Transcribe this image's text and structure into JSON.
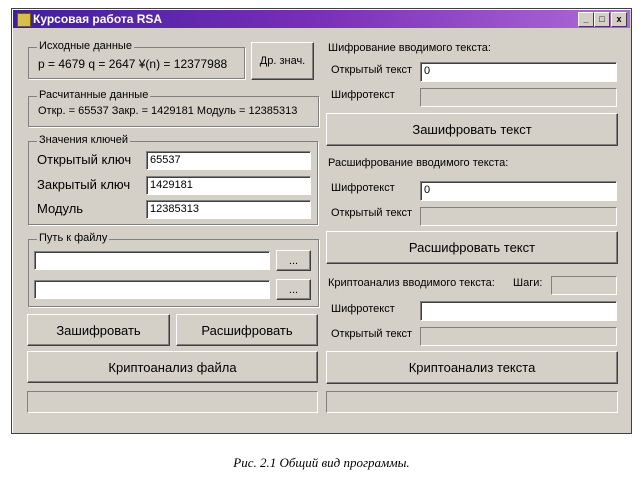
{
  "window": {
    "title": "Курсовая работа RSA",
    "minimize": "_",
    "maximize": "□",
    "close": "x"
  },
  "source": {
    "legend": "Исходные данные",
    "values": "p = 4679  q = 2647  ¥(n) = 12377988",
    "other_button": "Др. знач."
  },
  "computed": {
    "legend": "Расчитанные данные",
    "values": "Откр. = 65537  Закр. = 1429181   Модуль = 12385313"
  },
  "keys": {
    "legend": "Значения ключей",
    "open_label": "Открытый ключ",
    "open_value": "65537",
    "closed_label": "Закрытый ключ",
    "closed_value": "1429181",
    "modulus_label": "Модуль",
    "modulus_value": "12385313"
  },
  "file": {
    "legend": "Путь к файлу",
    "path1": "",
    "path2": "",
    "browse1": "...",
    "browse2": "..."
  },
  "left_buttons": {
    "encrypt": "Зашифровать",
    "decrypt": "Расшифровать",
    "cryptanalysis_file": "Криптоанализ файла"
  },
  "encrypt_text": {
    "heading": "Шифрование вводимого текста:",
    "plain_label": "Открытый текст",
    "plain_value": "0",
    "cipher_label": "Шифротекст",
    "button": "Зашифровать текст"
  },
  "decrypt_text": {
    "heading": "Расшифрование вводимого текста:",
    "cipher_label": "Шифротекст",
    "cipher_value": "0",
    "plain_label": "Открытый текст",
    "button": "Расшифровать текст"
  },
  "crypto_text": {
    "heading": "Криптоанализ вводимого текста:",
    "steps_label": "Шаги:",
    "cipher_label": "Шифротекст",
    "cipher_value": "",
    "plain_label": "Открытый текст",
    "button": "Криптоанализ текста"
  },
  "caption": "Рис. 2.1 Общий вид программы."
}
